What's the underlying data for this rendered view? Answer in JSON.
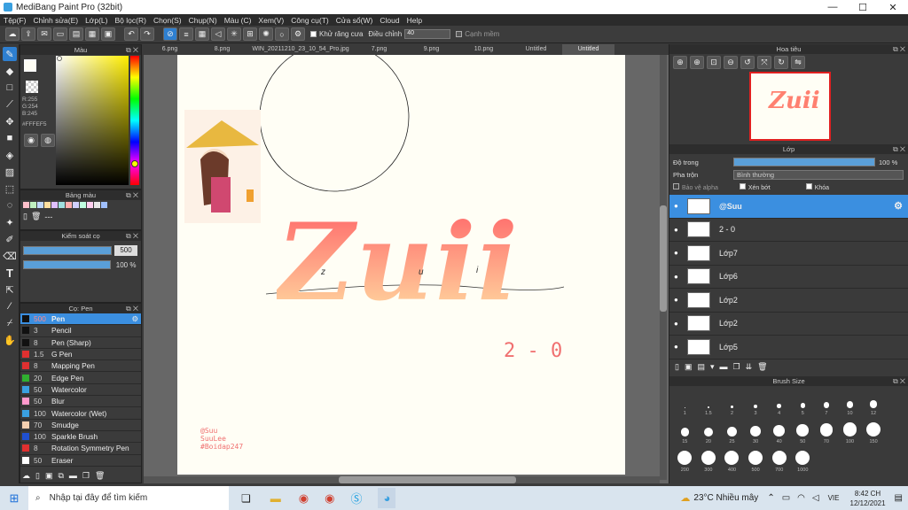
{
  "window": {
    "title": "MediBang Paint Pro (32bit)",
    "min": "—",
    "max": "☐",
    "close": "✕"
  },
  "menu": [
    "Tệp(F)",
    "Chỉnh sửa(E)",
    "Lớp(L)",
    "Bộ lọc(R)",
    "Chọn(S)",
    "Chụp(N)",
    "Màu (C)",
    "Xem(V)",
    "Công cụ(T)",
    "Cửa sổ(W)",
    "Cloud",
    "Help"
  ],
  "toolbar": {
    "antialias_label": "Khử răng cưa",
    "adjust_label": "Điều chỉnh",
    "adjust_value": "40",
    "sharp_label": "Cạnh mềm"
  },
  "tabs": [
    "6.png",
    "8.png",
    "WIN_20211210_23_10_54_Pro.jpg",
    "7.png",
    "9.png",
    "10.png",
    "Untitled",
    "Untitled"
  ],
  "color_panel": {
    "title": "Màu",
    "r": "R:255",
    "g": "G:254",
    "b": "B:245",
    "hex": "#FFFEF5",
    "fg": "#fffef5",
    "bg": "#ffe9a0"
  },
  "palette_panel": {
    "title": "Bảng màu",
    "dots": "---",
    "swatches": [
      "#ffc0cb",
      "#c0f0c0",
      "#c0d8ff",
      "#ffe0a0",
      "#e0c0ff",
      "#a0e0e0",
      "#ffb0b0",
      "#d0d0ff",
      "#c0ffe0",
      "#ffd0f0",
      "#e8e8e8",
      "#a0c0ff"
    ]
  },
  "brush_control": {
    "title": "Kiểm soát cọ",
    "size": "500",
    "opacity": "100 %",
    "size_fill": 1.0,
    "opacity_fill": 1.0
  },
  "brush_panel": {
    "title": "Cọ: Pen",
    "brushes": [
      {
        "size": "500",
        "name": "Pen",
        "color": "#111111",
        "sel": true
      },
      {
        "size": "3",
        "name": "Pencil",
        "color": "#111111"
      },
      {
        "size": "8",
        "name": "Pen (Sharp)",
        "color": "#111111"
      },
      {
        "size": "1.5",
        "name": "G Pen",
        "color": "#e03030"
      },
      {
        "size": "8",
        "name": "Mapping Pen",
        "color": "#e03030"
      },
      {
        "size": "20",
        "name": "Edge Pen",
        "color": "#30b030"
      },
      {
        "size": "50",
        "name": "Watercolor",
        "color": "#3aa0e0"
      },
      {
        "size": "50",
        "name": "Blur",
        "color": "#ff99cc"
      },
      {
        "size": "100",
        "name": "Watercolor (Wet)",
        "color": "#3aa0e0"
      },
      {
        "size": "70",
        "name": "Smudge",
        "color": "#f5d0b0"
      },
      {
        "size": "100",
        "name": "Sparkle Brush",
        "color": "#2050d0"
      },
      {
        "size": "8",
        "name": "Rotation Symmetry Pen",
        "color": "#e03030"
      },
      {
        "size": "50",
        "name": "Eraser",
        "color": "#ffffff"
      }
    ]
  },
  "artwork": {
    "title_text": "Zuii",
    "sub_text": "2 - 0",
    "handle_1": "@Suu",
    "handle_2": "SuuLee",
    "handle_3": "#Boidap247",
    "curve_letters": [
      "z",
      "u",
      "i"
    ]
  },
  "navigator": {
    "title": "Hoa tiêu"
  },
  "layer_panel": {
    "title": "Lớp",
    "opacity_label": "Độ trong",
    "opacity_value": "100 %",
    "opacity_fill": 1.0,
    "blend_label": "Pha trộn",
    "blend_value": "Bình thường",
    "protect_alpha": "Bảo vệ alpha",
    "clip": "Xén bớt",
    "lock": "Khóa",
    "layers": [
      {
        "name": "@Suu",
        "sel": true
      },
      {
        "name": "2 - 0"
      },
      {
        "name": "Lớp7"
      },
      {
        "name": "Lớp6"
      },
      {
        "name": "Lớp2"
      },
      {
        "name": "Lớp2"
      },
      {
        "name": "Lớp5"
      }
    ]
  },
  "brush_size": {
    "title": "Brush Size",
    "sizes": [
      "1",
      "1.5",
      "2",
      "3",
      "4",
      "5",
      "7",
      "10",
      "12",
      "15",
      "20",
      "25",
      "30",
      "40",
      "50",
      "70",
      "100",
      "150",
      "200",
      "300",
      "400",
      "500",
      "700",
      "1000"
    ]
  },
  "taskbar": {
    "search_placeholder": "Nhập tại đây để tìm kiếm",
    "weather": "23°C  Nhiều mây",
    "lang": "VIE",
    "time": "8:42 CH",
    "date": "12/12/2021"
  }
}
